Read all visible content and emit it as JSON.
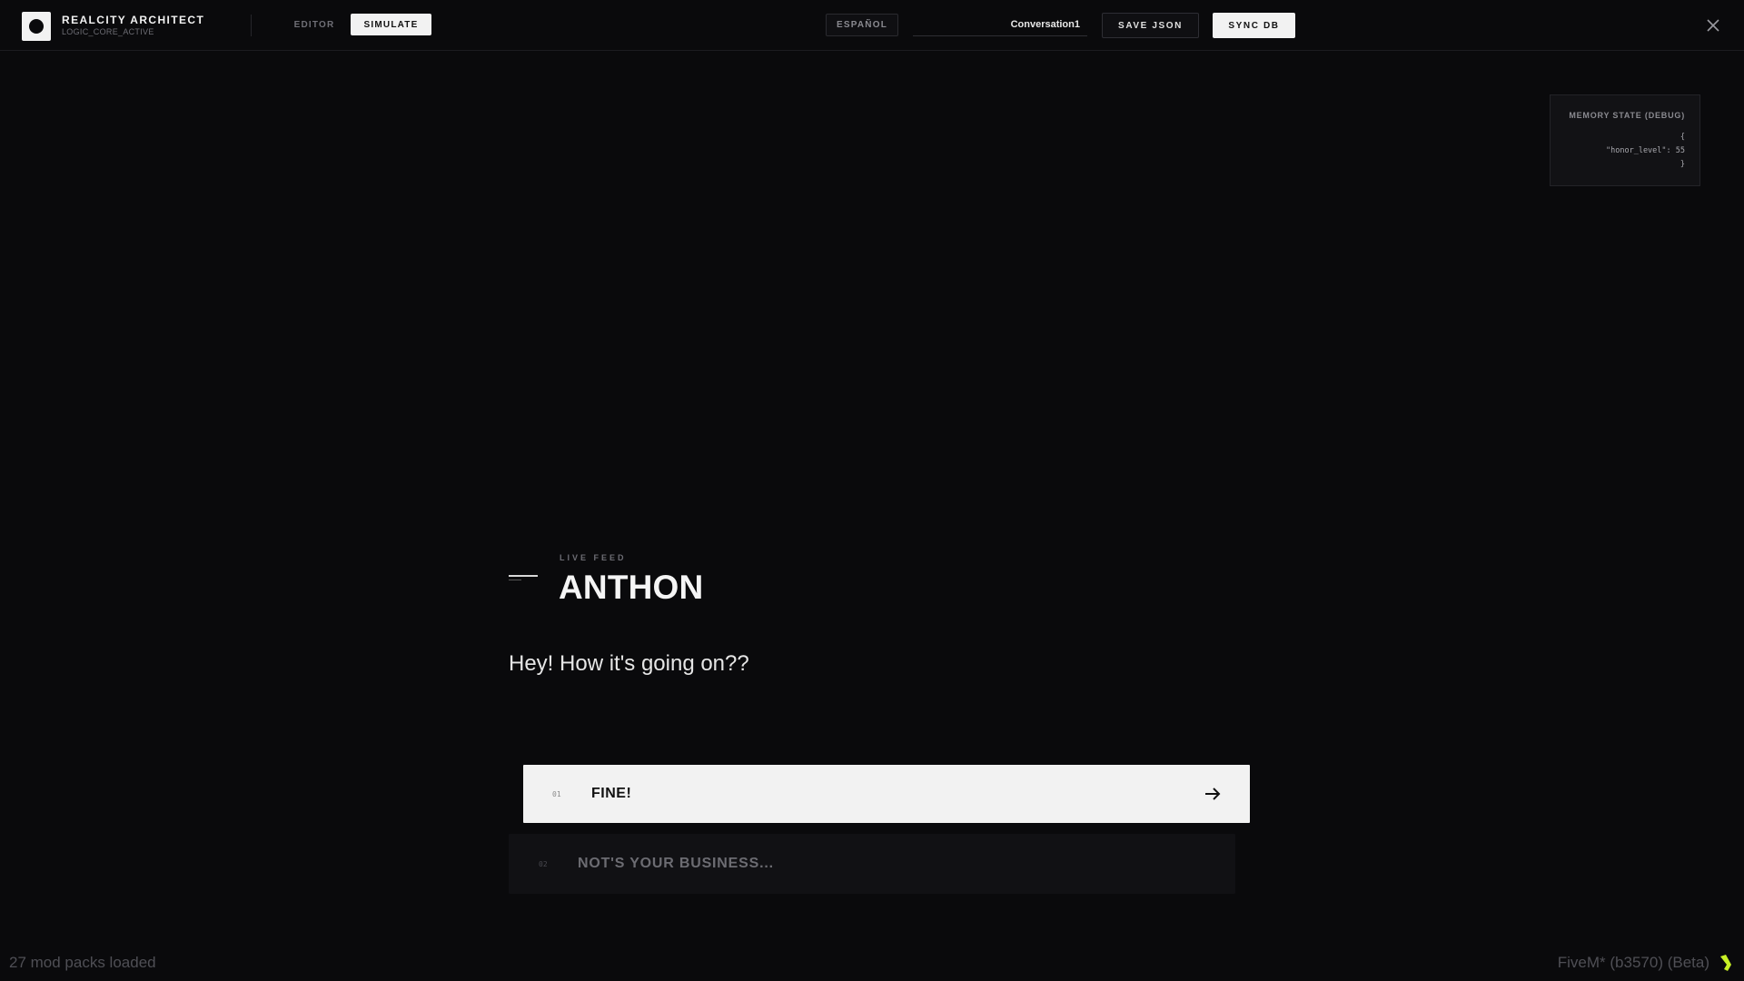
{
  "app": {
    "title": "REALCITY ARCHITECT",
    "subtitle": "LOGIC_CORE_ACTIVE"
  },
  "modes": {
    "editor_label": "EDITOR",
    "simulate_label": "SIMULATE",
    "active": "SIMULATE"
  },
  "toolbar": {
    "language_label": "ESPAÑOL",
    "conversation_value": "Conversation1",
    "save_label": "SAVE JSON",
    "sync_label": "SYNC DB"
  },
  "debug": {
    "title": "MEMORY STATE (DEBUG)",
    "code": "{\n\"honor_level\": 55\n}"
  },
  "feed": {
    "label": "LIVE FEED",
    "speaker": "ANTHON",
    "dialogue": "Hey! How it's going on??"
  },
  "options": [
    {
      "number": "01",
      "label": "FINE!",
      "selected": true
    },
    {
      "number": "02",
      "label": "NOT'S YOUR BUSINESS...",
      "selected": false
    }
  ],
  "footer": {
    "mods_status": "27 mod packs loaded",
    "client_version": "FiveM* (b3570) (Beta)"
  },
  "colors": {
    "background": "#0a0a0c",
    "accent_light": "#f2f2f2",
    "fivem_icon": "#c8f026"
  },
  "icons": [
    "logo-icon",
    "close-icon",
    "arrow-right-icon",
    "fivem-icon"
  ]
}
